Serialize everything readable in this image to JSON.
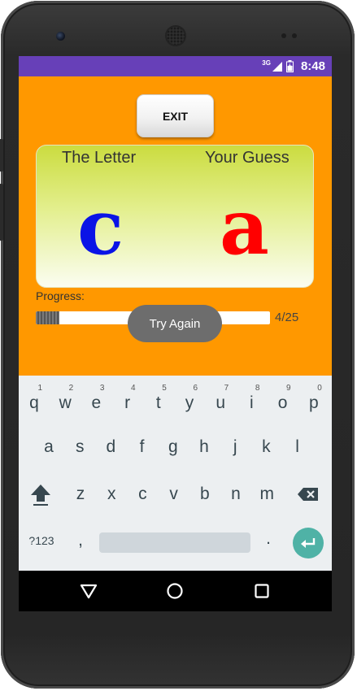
{
  "status_bar": {
    "network": "3G",
    "time": "8:48"
  },
  "exit_button": {
    "label": "EXIT"
  },
  "comparison": {
    "letter_header": "The Letter",
    "guess_header": "Your Guess",
    "letter": "c",
    "guess": "a",
    "letter_color": "#0a14e6",
    "guess_color": "#ff0000"
  },
  "progress": {
    "label": "Progress:",
    "count": "4/25",
    "fraction": 0.1
  },
  "toast": {
    "message": "Try Again"
  },
  "keyboard": {
    "row1": [
      {
        "ch": "q",
        "hint": "1"
      },
      {
        "ch": "w",
        "hint": "2"
      },
      {
        "ch": "e",
        "hint": "3"
      },
      {
        "ch": "r",
        "hint": "4"
      },
      {
        "ch": "t",
        "hint": "5"
      },
      {
        "ch": "y",
        "hint": "6"
      },
      {
        "ch": "u",
        "hint": "7"
      },
      {
        "ch": "i",
        "hint": "8"
      },
      {
        "ch": "o",
        "hint": "9"
      },
      {
        "ch": "p",
        "hint": "0"
      }
    ],
    "row2": [
      "a",
      "s",
      "d",
      "f",
      "g",
      "h",
      "j",
      "k",
      "l"
    ],
    "row3": [
      "z",
      "x",
      "c",
      "v",
      "b",
      "n",
      "m"
    ],
    "symbols_label": "?123",
    "comma": ",",
    "period": "."
  },
  "icons": {
    "shift": "shift-arrow-icon",
    "backspace": "backspace-icon",
    "enter": "enter-icon",
    "back": "back-triangle-icon",
    "home": "home-circle-icon",
    "recents": "recents-square-icon"
  },
  "colors": {
    "status_bar": "#6740b8",
    "app_background": "#ff9800",
    "enter_key": "#4fb2a6"
  }
}
